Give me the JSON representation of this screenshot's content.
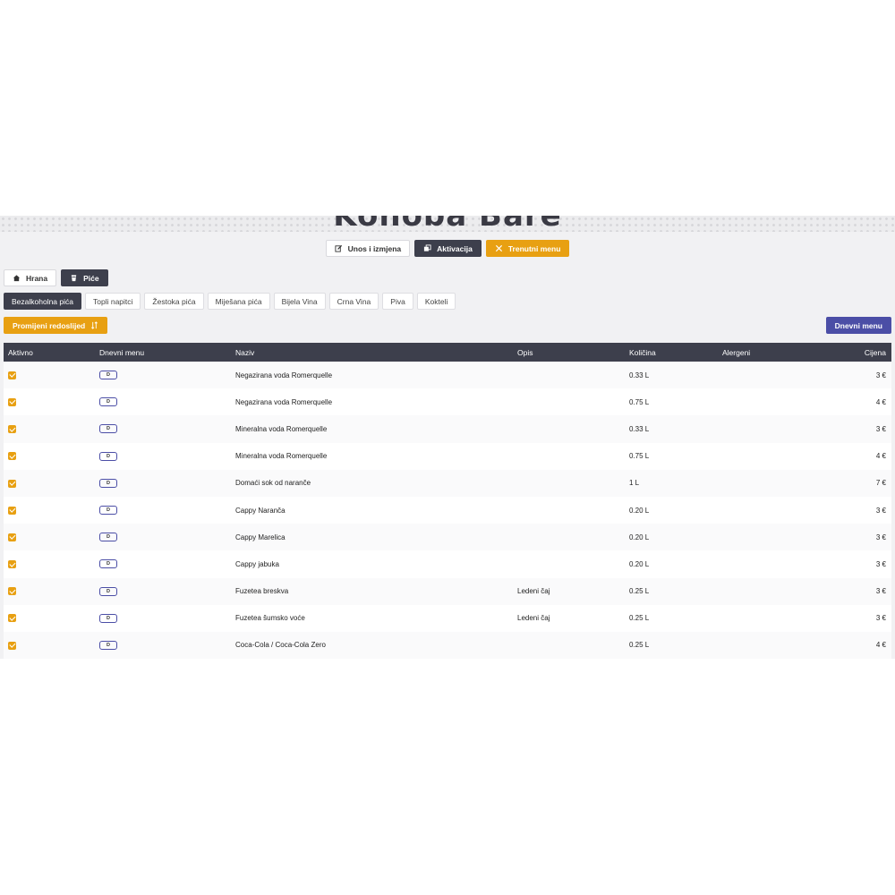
{
  "banner": {
    "title": "Konoba Bare"
  },
  "top_actions": [
    {
      "label": "Unos i izmjena",
      "icon": "edit-icon"
    },
    {
      "label": "Aktivacija",
      "icon": "copy-icon"
    },
    {
      "label": "Trenutni menu",
      "icon": "utensils-icon"
    }
  ],
  "categories": [
    {
      "label": "Hrana",
      "icon": "home-icon",
      "active": false
    },
    {
      "label": "Piće",
      "icon": "cup-icon",
      "active": true
    }
  ],
  "subcategories": [
    {
      "label": "Bezalkoholna pića",
      "active": true
    },
    {
      "label": "Topli napitci",
      "active": false
    },
    {
      "label": "Žestoka pića",
      "active": false
    },
    {
      "label": "Miješana pića",
      "active": false
    },
    {
      "label": "Bijela Vina",
      "active": false
    },
    {
      "label": "Crna Vina",
      "active": false
    },
    {
      "label": "Piva",
      "active": false
    },
    {
      "label": "Kokteli",
      "active": false
    }
  ],
  "actions": {
    "change_order": "Promijeni redoslijed",
    "change_order_icon": "sort-icon",
    "daily_menu": "Dnevni menu"
  },
  "colors": {
    "accent": "#e8a012",
    "dark": "#3d3f4c",
    "primary": "#4b4ea6"
  },
  "table": {
    "columns": [
      "Aktivno",
      "Dnevni menu",
      "Naziv",
      "Opis",
      "Količina",
      "Alergeni",
      "Cijena"
    ],
    "badge_label": "D",
    "rows": [
      {
        "active": true,
        "name": "Negazirana voda Romerquelle",
        "desc": "",
        "qty": "0.33 L",
        "allergens": "",
        "price": "3 €"
      },
      {
        "active": true,
        "name": "Negazirana voda Romerquelle",
        "desc": "",
        "qty": "0.75 L",
        "allergens": "",
        "price": "4 €"
      },
      {
        "active": true,
        "name": "Mineralna voda Romerquelle",
        "desc": "",
        "qty": "0.33 L",
        "allergens": "",
        "price": "3 €"
      },
      {
        "active": true,
        "name": "Mineralna voda Romerquelle",
        "desc": "",
        "qty": "0.75 L",
        "allergens": "",
        "price": "4 €"
      },
      {
        "active": true,
        "name": "Domaći sok od naranče",
        "desc": "",
        "qty": "1 L",
        "allergens": "",
        "price": "7 €"
      },
      {
        "active": true,
        "name": "Cappy Naranča",
        "desc": "",
        "qty": "0.20 L",
        "allergens": "",
        "price": "3 €"
      },
      {
        "active": true,
        "name": "Cappy Marelica",
        "desc": "",
        "qty": "0.20 L",
        "allergens": "",
        "price": "3 €"
      },
      {
        "active": true,
        "name": "Cappy jabuka",
        "desc": "",
        "qty": "0.20 L",
        "allergens": "",
        "price": "3 €"
      },
      {
        "active": true,
        "name": "Fuzetea breskva",
        "desc": "Ledeni čaj",
        "qty": "0.25 L",
        "allergens": "",
        "price": "3 €"
      },
      {
        "active": true,
        "name": "Fuzetea šumsko voće",
        "desc": "Ledeni čaj",
        "qty": "0.25 L",
        "allergens": "",
        "price": "3 €"
      },
      {
        "active": true,
        "name": "Coca-Cola / Coca-Cola Zero",
        "desc": "",
        "qty": "0.25 L",
        "allergens": "",
        "price": "4 €"
      }
    ]
  }
}
